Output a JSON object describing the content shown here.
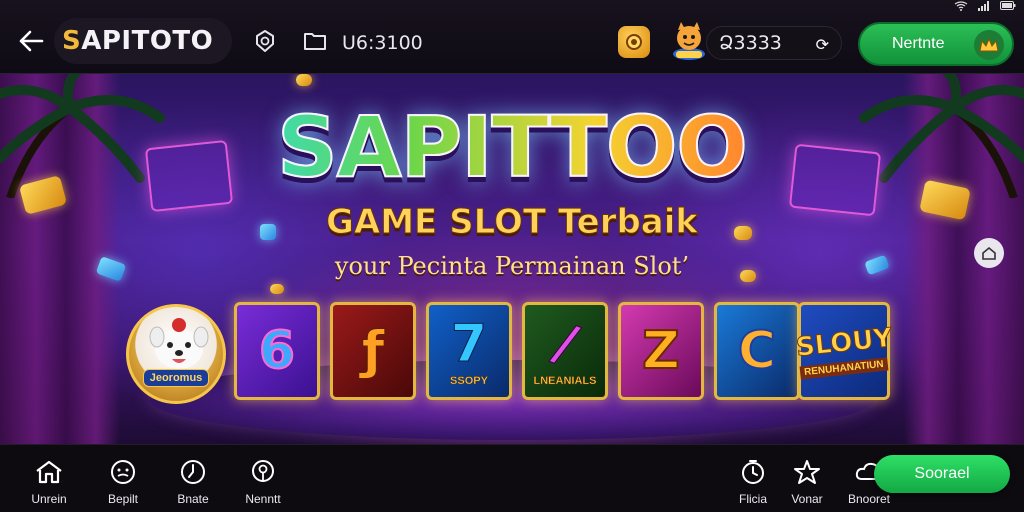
{
  "header": {
    "logo_first": "S",
    "logo_rest": "APITOTO",
    "balance": "U6:3100",
    "wallet": "Ձ3333",
    "cta_label": "Nertnte"
  },
  "banner": {
    "title": "SAPITTOO",
    "subtitle": "GAME SLOT Terbaik",
    "tagline": "your Pecinta Permainan Slot’",
    "tiles": [
      {
        "glyph": "",
        "label": "",
        "icon": "mascot"
      },
      {
        "glyph": "6",
        "label": "",
        "icon": "slot-6"
      },
      {
        "glyph": "ƒ",
        "label": "",
        "icon": "slot-s"
      },
      {
        "glyph": "7",
        "label": "SSOPY",
        "icon": "slot-7"
      },
      {
        "glyph": "/",
        "label": "LNEANIALS",
        "icon": "slot-slash"
      },
      {
        "glyph": "Z",
        "label": "",
        "icon": "slot-z"
      },
      {
        "glyph": "C",
        "label": "",
        "icon": "slot-c"
      }
    ],
    "mascot_label": "Jeoromus",
    "logo_tile_big": "SLOUY",
    "logo_tile_small": "RENUHANATIUN"
  },
  "bottom_nav": {
    "left": [
      {
        "label": "Unrein",
        "icon": "home-icon"
      },
      {
        "label": "Bepilt",
        "icon": "face-icon"
      },
      {
        "label": "Bnate",
        "icon": "clock-icon"
      },
      {
        "label": "Nenntt",
        "icon": "pin-icon"
      }
    ],
    "right": [
      {
        "label": "Flicia",
        "icon": "timer-icon"
      },
      {
        "label": "Vonar",
        "icon": "star-icon"
      },
      {
        "label": "Bnooret",
        "icon": "cloud-icon"
      }
    ],
    "primary_label": "Soorael"
  },
  "colors": {
    "accent_green": "#2ee066",
    "gold": "#f2b93a",
    "purple_bg": "#4a1f8a"
  }
}
